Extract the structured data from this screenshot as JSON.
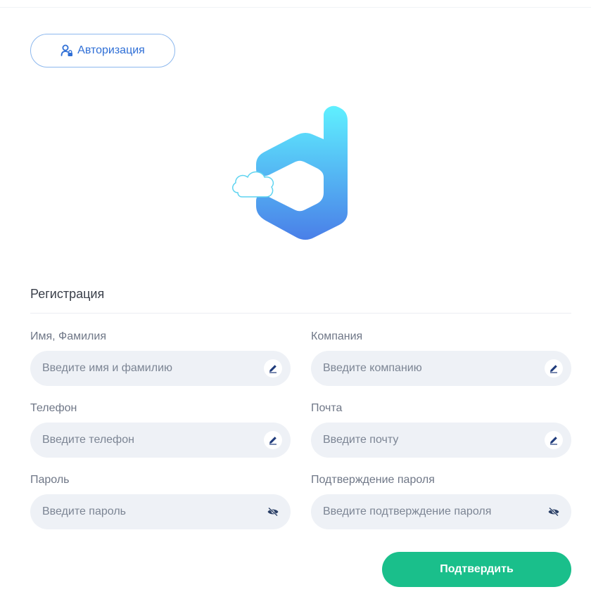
{
  "header": {
    "auth_button": {
      "label": "Авторизация",
      "icon": "user-lock-icon",
      "color": "#2f6fd6"
    }
  },
  "logo": {
    "icon": "app-logo-icon",
    "colors": [
      "#5ff0ff",
      "#4a7fe8"
    ]
  },
  "form": {
    "title": "Регистрация",
    "fields": [
      {
        "label": "Имя, Фамилия",
        "placeholder": "Введите имя и фамилию",
        "icon": "pencil-icon"
      },
      {
        "label": "Компания",
        "placeholder": "Введите компанию",
        "icon": "pencil-icon"
      },
      {
        "label": "Телефон",
        "placeholder": "Введите телефон",
        "icon": "pencil-icon"
      },
      {
        "label": "Почта",
        "placeholder": "Введите почту",
        "icon": "pencil-icon"
      },
      {
        "label": "Пароль",
        "placeholder": "Введите пароль",
        "icon": "eye-off-icon"
      },
      {
        "label": "Подтверждение пароля",
        "placeholder": "Введите подтверждение пароля",
        "icon": "eye-off-icon"
      }
    ],
    "submit_label": "Подтвердить",
    "submit_color": "#1abf8b"
  }
}
